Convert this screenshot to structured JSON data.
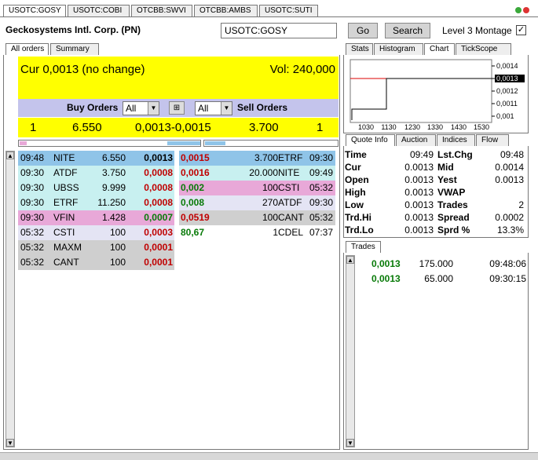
{
  "top_tabs": [
    "USOTC:GOSY",
    "USOTC:COBI",
    "OTCBB:SWVI",
    "OTCBB:AMBS",
    "USOTC:SUTI"
  ],
  "company_name": "Geckosystems Intl. Corp. (PN)",
  "symbol_input": "USOTC:GOSY",
  "go_label": "Go",
  "search_label": "Search",
  "level3_label": "Level 3 Montage",
  "level3_checked": true,
  "left_tabs": [
    "All orders",
    "Summary"
  ],
  "cur_text": "Cur 0,0013 (no change)",
  "vol_text": "Vol: 240,000",
  "buy_orders_label": "Buy Orders",
  "sell_orders_label": "Sell Orders",
  "buy_filter": "All",
  "sell_filter": "All",
  "summary": {
    "buy_count": "1",
    "buy_size": "6.550",
    "spread": "0,0013-0,0015",
    "sell_size": "3.700",
    "sell_count": "1"
  },
  "buy_rows": [
    {
      "time": "09:48",
      "mm": "NITE",
      "size": "6.550",
      "price": "0,0013",
      "pcolor": "blk",
      "bg": "#8fc4e8"
    },
    {
      "time": "09:30",
      "mm": "ATDF",
      "size": "3.750",
      "price": "0,0008",
      "pcolor": "red",
      "bg": "#c8f0f0"
    },
    {
      "time": "09:30",
      "mm": "UBSS",
      "size": "9.999",
      "price": "0,0008",
      "pcolor": "red",
      "bg": "#c8f0f0"
    },
    {
      "time": "09:30",
      "mm": "ETRF",
      "size": "11.250",
      "price": "0,0008",
      "pcolor": "red",
      "bg": "#c8f0f0"
    },
    {
      "time": "09:30",
      "mm": "VFIN",
      "size": "1.428",
      "price": "0,0007",
      "pcolor": "grn",
      "bg": "#e8a8d8"
    },
    {
      "time": "05:32",
      "mm": "CSTI",
      "size": "100",
      "price": "0,0003",
      "pcolor": "red",
      "bg": "#e4e4f4"
    },
    {
      "time": "05:32",
      "mm": "MAXM",
      "size": "100",
      "price": "0,0001",
      "pcolor": "red",
      "bg": "#cfcfcf"
    },
    {
      "time": "05:32",
      "mm": "CANT",
      "size": "100",
      "price": "0,0001",
      "pcolor": "red",
      "bg": "#cfcfcf"
    }
  ],
  "sell_rows": [
    {
      "price": "0,0015",
      "size": "3.700",
      "mm": "ETRF",
      "time": "09:30",
      "pcolor": "red",
      "bg": "#8fc4e8"
    },
    {
      "price": "0,0016",
      "size": "20.000",
      "mm": "NITE",
      "time": "09:49",
      "pcolor": "red",
      "bg": "#c8f0f0"
    },
    {
      "price": "0,002",
      "size": "100",
      "mm": "CSTI",
      "time": "05:32",
      "pcolor": "grn",
      "bg": "#e8a8d8"
    },
    {
      "price": "0,008",
      "size": "270",
      "mm": "ATDF",
      "time": "09:30",
      "pcolor": "grn",
      "bg": "#e4e4f4"
    },
    {
      "price": "0,0519",
      "size": "100",
      "mm": "CANT",
      "time": "05:32",
      "pcolor": "red",
      "bg": "#cfcfcf"
    },
    {
      "price": "80,67",
      "size": "1",
      "mm": "CDEL",
      "time": "07:37",
      "pcolor": "grn",
      "bg": "#ffffff"
    }
  ],
  "right_tabs": [
    "Stats",
    "Histogram",
    "Chart",
    "TickScope"
  ],
  "chart_data": {
    "type": "line",
    "x_ticks": [
      "1030",
      "1130",
      "1230",
      "1330",
      "1430",
      "1530"
    ],
    "y_ticks": [
      "0,0014",
      "0,0013",
      "0,0012",
      "0,0011",
      "0,001"
    ],
    "highlight": "0,0013",
    "ylim": [
      0.00095,
      0.00145
    ]
  },
  "info_tabs": [
    "Quote Info",
    "Auction",
    "Indices",
    "Flow"
  ],
  "quote_info": [
    {
      "l1": "Time",
      "v1": "09:49",
      "l2": "Lst.Chg",
      "v2": "09:48"
    },
    {
      "l1": "Cur",
      "v1": "0.0013",
      "l2": "Mid",
      "v2": "0.0014"
    },
    {
      "l1": "Open",
      "v1": "0.0013",
      "l2": "Yest",
      "v2": "0.0013"
    },
    {
      "l1": "High",
      "v1": "0.0013",
      "l2": "VWAP",
      "v2": ""
    },
    {
      "l1": "Low",
      "v1": "0.0013",
      "l2": "Trades",
      "v2": "2"
    },
    {
      "l1": "Trd.Hi",
      "v1": "0.0013",
      "l2": "Spread",
      "v2": "0.0002"
    },
    {
      "l1": "Trd.Lo",
      "v1": "0.0013",
      "l2": "Sprd %",
      "v2": "13.3%"
    }
  ],
  "trades_tab": "Trades",
  "trades": [
    {
      "price": "0,0013",
      "size": "175.000",
      "time": "09:48:06"
    },
    {
      "price": "0,0013",
      "size": "65.000",
      "time": "09:30:15"
    }
  ]
}
